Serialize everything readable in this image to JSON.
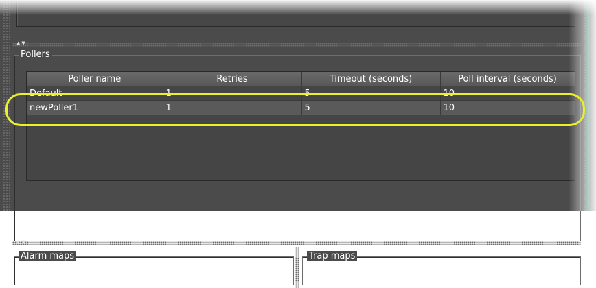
{
  "pollers": {
    "title": "Pollers",
    "columns": [
      "Poller name",
      "Retries",
      "Timeout (seconds)",
      "Poll interval (seconds)"
    ],
    "rows": [
      {
        "name": "Default",
        "retries": "1",
        "timeout": "5",
        "interval": "10"
      },
      {
        "name": "newPoller1",
        "retries": "1",
        "timeout": "5",
        "interval": "10"
      }
    ]
  },
  "bottom": {
    "alarm_title": "Alarm maps",
    "trap_title": "Trap maps"
  },
  "colors": {
    "highlight": "#ecef2b",
    "background": "#4b4b4b"
  }
}
